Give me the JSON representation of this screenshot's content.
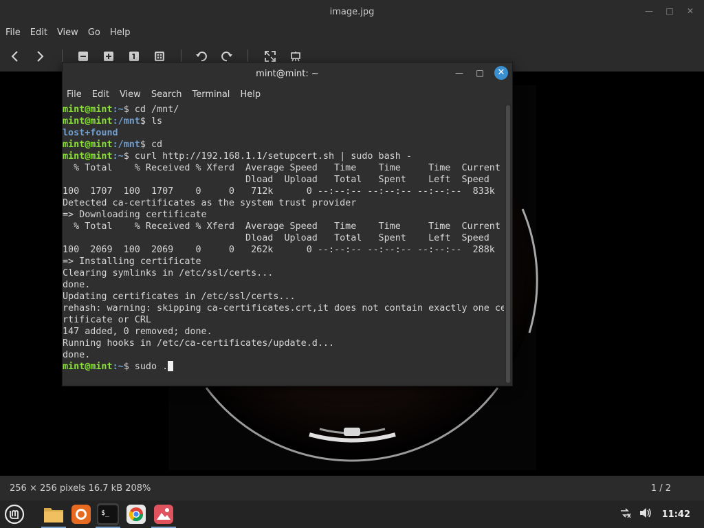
{
  "viewer": {
    "title": "image.jpg",
    "menu": [
      "File",
      "Edit",
      "View",
      "Go",
      "Help"
    ],
    "status_info": "256 × 256 pixels   16.7 kB   208%",
    "page_indicator": "1 / 2"
  },
  "terminal": {
    "title": "mint@mint: ~",
    "menu": [
      "File",
      "Edit",
      "View",
      "Search",
      "Terminal",
      "Help"
    ],
    "lines": [
      {
        "user": "mint@mint",
        "path": ":~",
        "rest": "$ cd /mnt/"
      },
      {
        "user": "mint@mint",
        "path": ":/mnt",
        "rest": "$ ls"
      },
      {
        "dir": "lost+found"
      },
      {
        "user": "mint@mint",
        "path": ":/mnt",
        "rest": "$ cd"
      },
      {
        "user": "mint@mint",
        "path": ":~",
        "rest": "$ curl http://192.168.1.1/setupcert.sh | sudo bash -"
      },
      {
        "text": "  % Total    % Received % Xferd  Average Speed   Time    Time     Time  Current"
      },
      {
        "text": "                                 Dload  Upload   Total   Spent    Left  Speed"
      },
      {
        "text": "100  1707  100  1707    0     0   712k      0 --:--:-- --:--:-- --:--:--  833k"
      },
      {
        "text": "Detected ca-certificates as the system trust provider"
      },
      {
        "text": "=> Downloading certificate"
      },
      {
        "text": "  % Total    % Received % Xferd  Average Speed   Time    Time     Time  Current"
      },
      {
        "text": "                                 Dload  Upload   Total   Spent    Left  Speed"
      },
      {
        "text": "100  2069  100  2069    0     0   262k      0 --:--:-- --:--:-- --:--:--  288k"
      },
      {
        "text": "=> Installing certificate"
      },
      {
        "text": "Clearing symlinks in /etc/ssl/certs..."
      },
      {
        "text": "done."
      },
      {
        "text": "Updating certificates in /etc/ssl/certs..."
      },
      {
        "text": "rehash: warning: skipping ca-certificates.crt,it does not contain exactly one ce"
      },
      {
        "text": "rtificate or CRL"
      },
      {
        "text": "147 added, 0 removed; done."
      },
      {
        "text": "Running hooks in /etc/ca-certificates/update.d..."
      },
      {
        "text": "done."
      },
      {
        "user": "mint@mint",
        "path": ":~",
        "rest": "$ sudo .",
        "cursor": true
      }
    ]
  },
  "taskbar": {
    "clock": "11:42",
    "apps": [
      "files-icon",
      "firefox-icon",
      "terminal-icon",
      "chrome-icon",
      "image-viewer-icon"
    ]
  },
  "colors": {
    "prompt_user": "#8ae234",
    "prompt_path": "#729fcf",
    "close_button": "#3a8fd1"
  }
}
